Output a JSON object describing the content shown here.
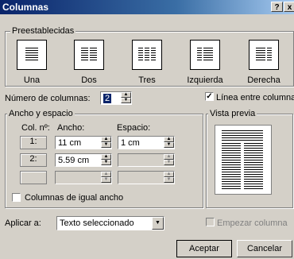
{
  "window": {
    "title": "Columnas",
    "help_label": "?",
    "close_label": "x"
  },
  "presets": {
    "legend": "Preestablecidas",
    "items": [
      {
        "label": "Una",
        "cols": 1
      },
      {
        "label": "Dos",
        "cols": 2
      },
      {
        "label": "Tres",
        "cols": 3
      },
      {
        "label": "Izquierda",
        "cols": 2
      },
      {
        "label": "Derecha",
        "cols": 2
      }
    ]
  },
  "num_columns": {
    "label": "Número de columnas:",
    "value": "2"
  },
  "line_between": {
    "label": "Línea entre columnas",
    "checked": true
  },
  "width_spacing": {
    "legend": "Ancho y espacio",
    "col_header": "Col. nº:",
    "width_header": "Ancho:",
    "spacing_header": "Espacio:",
    "rows": [
      {
        "num": "1:",
        "width": "11 cm",
        "spacing": "1 cm"
      },
      {
        "num": "2:",
        "width": "5.59 cm",
        "spacing": ""
      },
      {
        "num": "",
        "width": "",
        "spacing": ""
      }
    ]
  },
  "equal_width": {
    "label": "Columnas de igual ancho",
    "checked": false
  },
  "preview": {
    "legend": "Vista previa"
  },
  "apply_to": {
    "label": "Aplicar a:",
    "value": "Texto seleccionado"
  },
  "start_column": {
    "label": "Empezar columna",
    "checked": false
  },
  "buttons": {
    "ok": "Aceptar",
    "cancel": "Cancelar"
  }
}
